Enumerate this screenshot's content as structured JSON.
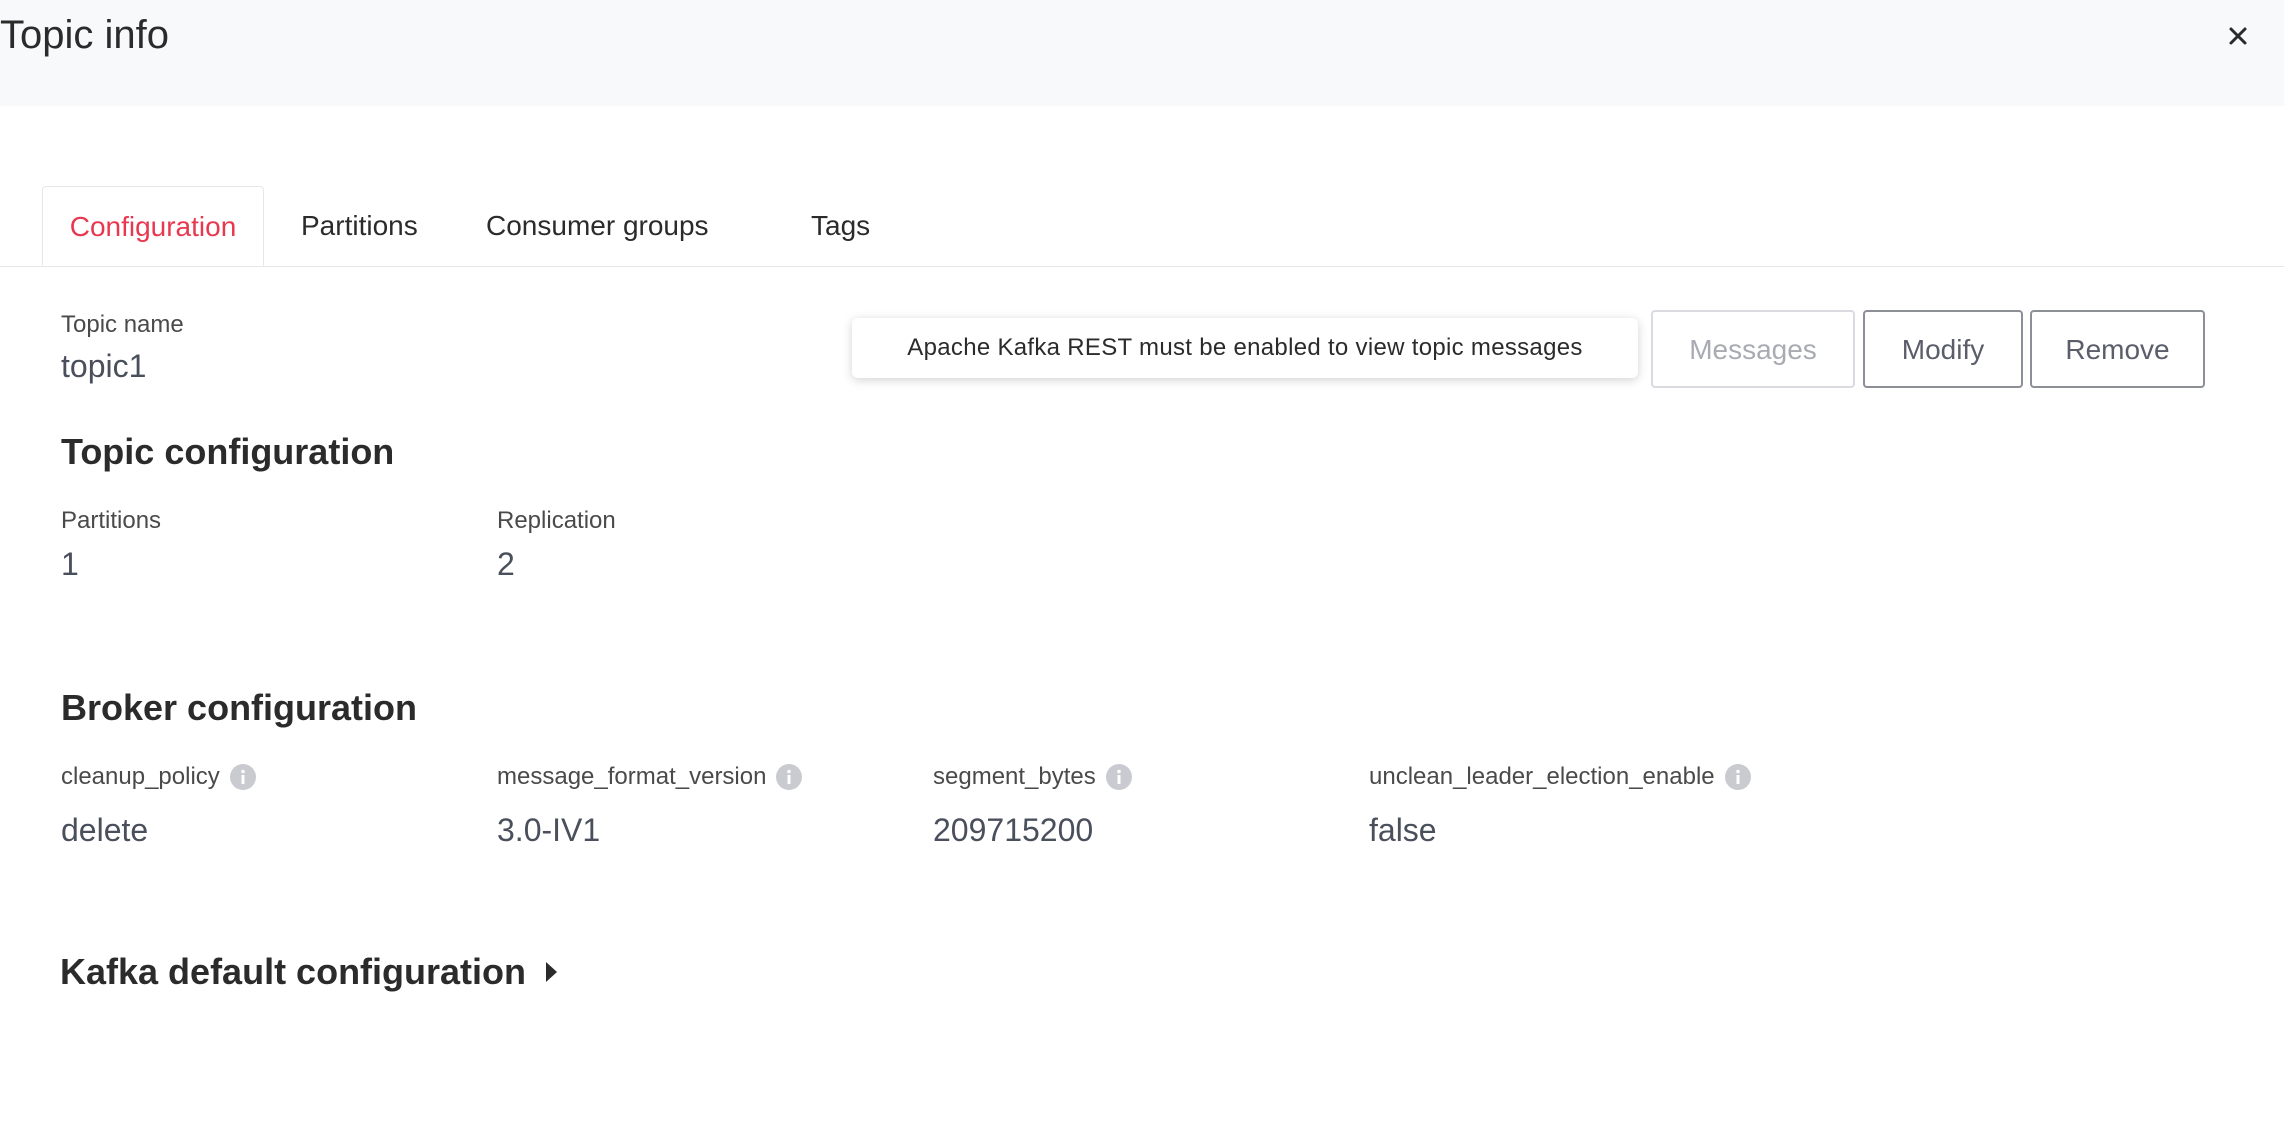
{
  "header": {
    "title": "Topic info",
    "close_icon": "close-icon"
  },
  "tabs": [
    {
      "label": "Configuration",
      "active": true
    },
    {
      "label": "Partitions",
      "active": false
    },
    {
      "label": "Consumer groups",
      "active": false
    },
    {
      "label": "Tags",
      "active": false
    }
  ],
  "topic": {
    "name_label": "Topic name",
    "name_value": "topic1"
  },
  "actions": {
    "tooltip": "Apache Kafka REST must be enabled to view topic messages",
    "messages_label": "Messages",
    "modify_label": "Modify",
    "remove_label": "Remove"
  },
  "topic_configuration": {
    "title": "Topic configuration",
    "partitions_label": "Partitions",
    "partitions_value": "1",
    "replication_label": "Replication",
    "replication_value": "2"
  },
  "broker_configuration": {
    "title": "Broker configuration",
    "items": [
      {
        "label": "cleanup_policy",
        "value": "delete"
      },
      {
        "label": "message_format_version",
        "value": "3.0-IV1"
      },
      {
        "label": "segment_bytes",
        "value": "209715200"
      },
      {
        "label": "unclean_leader_election_enable",
        "value": "false"
      }
    ]
  },
  "kafka_default": {
    "title": "Kafka default configuration"
  },
  "colors": {
    "accent": "#e8384f",
    "header_bg": "#f8f9fa",
    "text": "#2b2b2b"
  }
}
